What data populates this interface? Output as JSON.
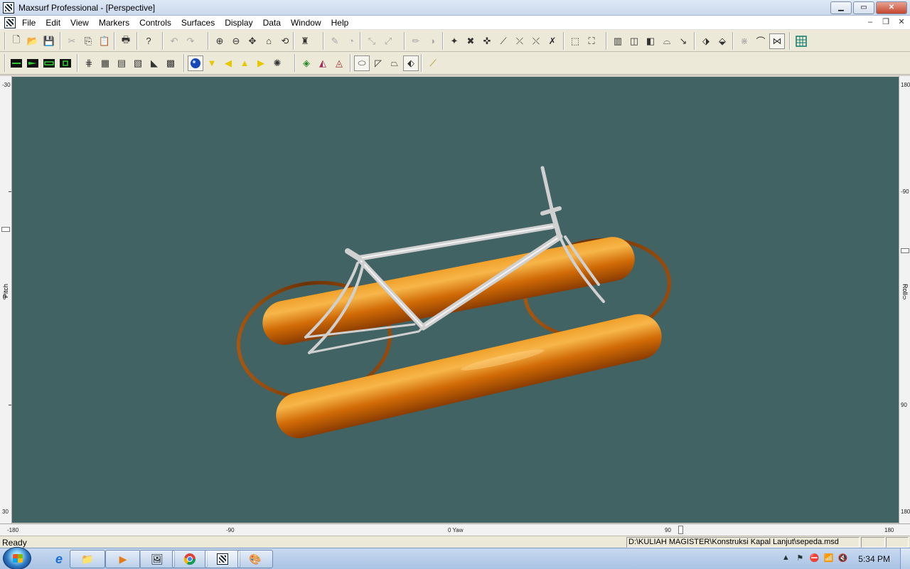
{
  "window": {
    "title": "Maxsurf Professional - [Perspective]",
    "buttons": {
      "minimize": "▁",
      "maximize": "▭",
      "close": "✕"
    }
  },
  "menu": {
    "items": [
      {
        "label": "File"
      },
      {
        "label": "Edit"
      },
      {
        "label": "View"
      },
      {
        "label": "Markers"
      },
      {
        "label": "Controls"
      },
      {
        "label": "Surfaces"
      },
      {
        "label": "Display"
      },
      {
        "label": "Data"
      },
      {
        "label": "Window"
      },
      {
        "label": "Help"
      }
    ],
    "mdi_buttons": {
      "minimize": "–",
      "restore": "❐",
      "close": "✕"
    }
  },
  "rulers": {
    "left": {
      "label": "Pitch",
      "ticks": [
        "-30",
        "0",
        "30"
      ]
    },
    "right": {
      "label": "Roll",
      "ticks": [
        "180",
        "-90",
        "0",
        "90",
        "180"
      ]
    },
    "bottom": {
      "ticks": [
        "-180",
        "-90",
        "0 Yaw",
        "90",
        "180"
      ]
    }
  },
  "status": {
    "text": "Ready",
    "file_path": "D:\\KULIAH MAGISTER\\Konstruksi Kapal Lanjut\\sepeda.msd"
  },
  "taskbar": {
    "time": "5:34 PM"
  },
  "colors": {
    "viewport_bg": "#426363",
    "pontoon": "#e07a0c",
    "frame": "#c8c8c8"
  }
}
